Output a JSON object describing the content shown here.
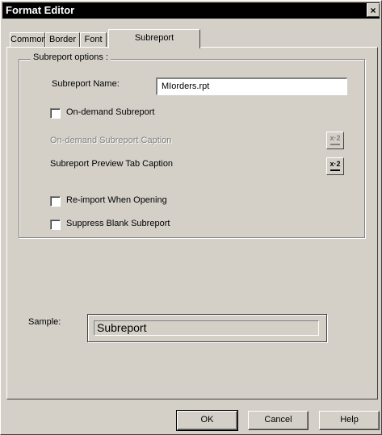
{
  "window": {
    "title": "Format Editor",
    "close_glyph": "×"
  },
  "tabs": [
    {
      "label": "Common",
      "active": false
    },
    {
      "label": "Border",
      "active": false
    },
    {
      "label": "Font",
      "active": false
    },
    {
      "label": "Subreport",
      "active": true
    }
  ],
  "group": {
    "legend": "Subreport options :"
  },
  "fields": {
    "subreport_name_label": "Subreport Name:",
    "subreport_name_value": "MIorders.rpt",
    "on_demand_label": "On-demand Subreport",
    "on_demand_checked": false,
    "on_demand_caption_label": "On-demand Subreport Caption",
    "preview_tab_caption_label": "Subreport Preview Tab Caption",
    "reimport_label": "Re-import When Opening",
    "reimport_checked": false,
    "suppress_blank_label": "Suppress Blank Subreport",
    "suppress_blank_checked": false
  },
  "formula_button": {
    "glyph": "x·2",
    "icon": "formula-icon"
  },
  "sample": {
    "label": "Sample:",
    "text": "Subreport"
  },
  "buttons": {
    "ok": "OK",
    "cancel": "Cancel",
    "help": "Help"
  }
}
